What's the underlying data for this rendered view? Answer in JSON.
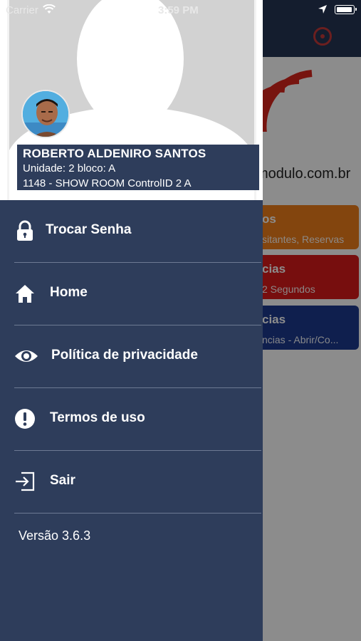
{
  "status_bar": {
    "carrier": "Carrier",
    "time": "3:59 PM"
  },
  "background": {
    "domain_text": "modulo.com.br",
    "cards": [
      {
        "title": "os",
        "subtitle": "sitantes, Reservas",
        "color": "#ef7e1a"
      },
      {
        "title": "cias",
        "subtitle": "2 Segundos",
        "color": "#d91a1a"
      },
      {
        "title": "cias",
        "subtitle": "ncias - Abrir/Co...",
        "color": "#1d3a8f"
      }
    ]
  },
  "drawer": {
    "user": {
      "name": "ROBERTO ALDENIRO SANTOS",
      "unit": "Unidade: 2 bloco: A",
      "location": "1148 - SHOW ROOM ControlID 2 A"
    },
    "menu": [
      {
        "label": "Trocar Senha",
        "icon": "lock-icon"
      },
      {
        "label": "Home",
        "icon": "home-icon"
      },
      {
        "label": "Política de privacidade",
        "icon": "eye-icon"
      },
      {
        "label": "Termos de uso",
        "icon": "alert-circle-icon"
      },
      {
        "label": "Sair",
        "icon": "logout-icon"
      }
    ],
    "version": "Versão 3.6.3"
  },
  "colors": {
    "drawer_bg": "#2e3d5b",
    "nav_bg": "#253554"
  }
}
